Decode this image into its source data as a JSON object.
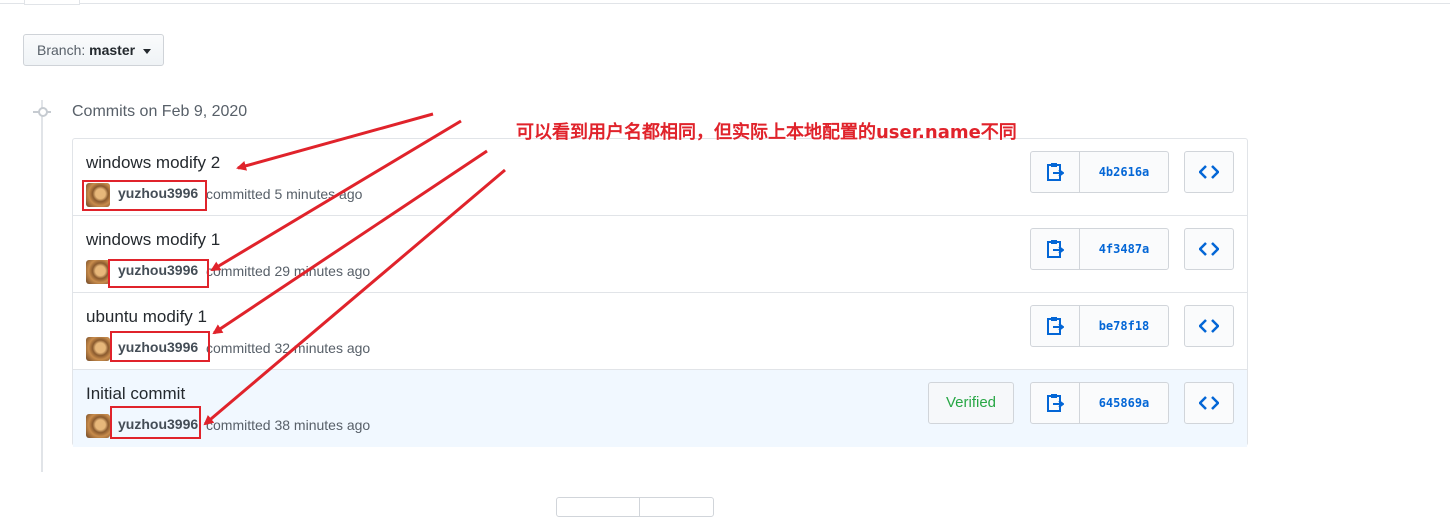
{
  "branch": {
    "label": "Branch:",
    "name": "master"
  },
  "timeline": {
    "heading": "Commits on Feb 9, 2020"
  },
  "commits": [
    {
      "title": "windows modify 2",
      "author": "yuzhou3996",
      "meta": "committed 5 minutes ago",
      "sha": "4b2616a",
      "verified": ""
    },
    {
      "title": "windows modify 1",
      "author": "yuzhou3996",
      "meta": "committed 29 minutes ago",
      "sha": "4f3487a",
      "verified": ""
    },
    {
      "title": "ubuntu modify 1",
      "author": "yuzhou3996",
      "meta": "committed 32 minutes ago",
      "sha": "be78f18",
      "verified": ""
    },
    {
      "title": "Initial commit",
      "author": "yuzhou3996",
      "meta": "committed 38 minutes ago",
      "sha": "645869a",
      "verified": "Verified"
    }
  ],
  "annotation": "可以看到用户名都相同，但实际上本地配置的user.name不同",
  "colors": {
    "link": "#0366d6",
    "annotation_red": "#e0232b",
    "verified_green": "#28a745"
  },
  "icons": {
    "copy": "clippy-icon",
    "browse": "code-icon",
    "caret": "caret-down-icon",
    "timeline": "git-commit-icon"
  }
}
